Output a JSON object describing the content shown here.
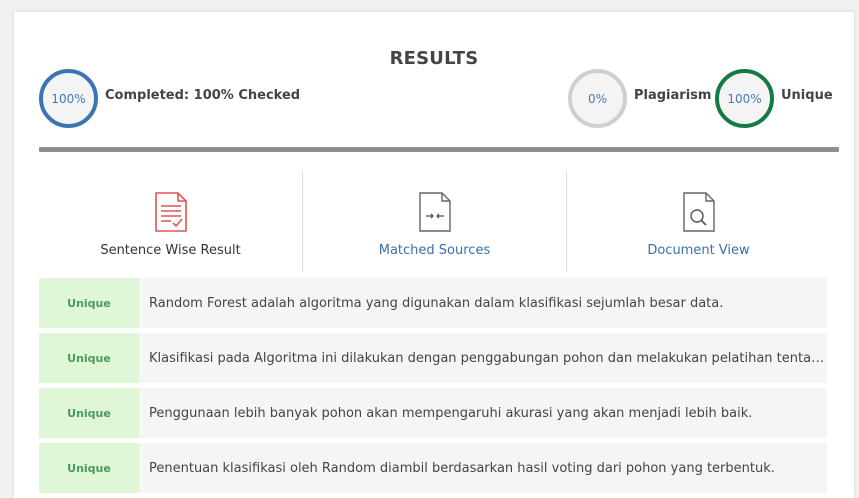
{
  "header": {
    "title": "RESULTS"
  },
  "stats": {
    "completed": {
      "percent": "100%",
      "label": "Completed: 100% Checked"
    },
    "plagiarism": {
      "percent": "0%",
      "label": "Plagiarism"
    },
    "unique": {
      "percent": "100%",
      "label": "Unique"
    }
  },
  "tabs": [
    {
      "label": "Sentence Wise Result",
      "icon": "document-check-icon"
    },
    {
      "label": "Matched Sources",
      "icon": "document-compare-icon"
    },
    {
      "label": "Document View",
      "icon": "document-search-icon"
    }
  ],
  "results": [
    {
      "status": "Unique",
      "sentence": "Random Forest adalah algoritma yang digunakan dalam klasifikasi sejumlah besar data."
    },
    {
      "status": "Unique",
      "sentence": "Klasifikasi pada Algoritma ini dilakukan dengan penggabungan pohon dan melakukan pelatihan tentan..."
    },
    {
      "status": "Unique",
      "sentence": "Penggunaan lebih banyak pohon akan mempengaruhi akurasi yang akan menjadi lebih baik."
    },
    {
      "status": "Unique",
      "sentence": "Penentuan klasifikasi oleh Random diambil berdasarkan hasil voting dari pohon yang terbentuk."
    }
  ],
  "colors": {
    "completed_ring": "#3d74b2",
    "plagiarism_ring": "#cfcfcf",
    "unique_ring": "#157a45",
    "unique_badge_bg": "#dff7d7",
    "active_tab_icon": "#e05555",
    "tab_link": "#3a6fa8"
  }
}
